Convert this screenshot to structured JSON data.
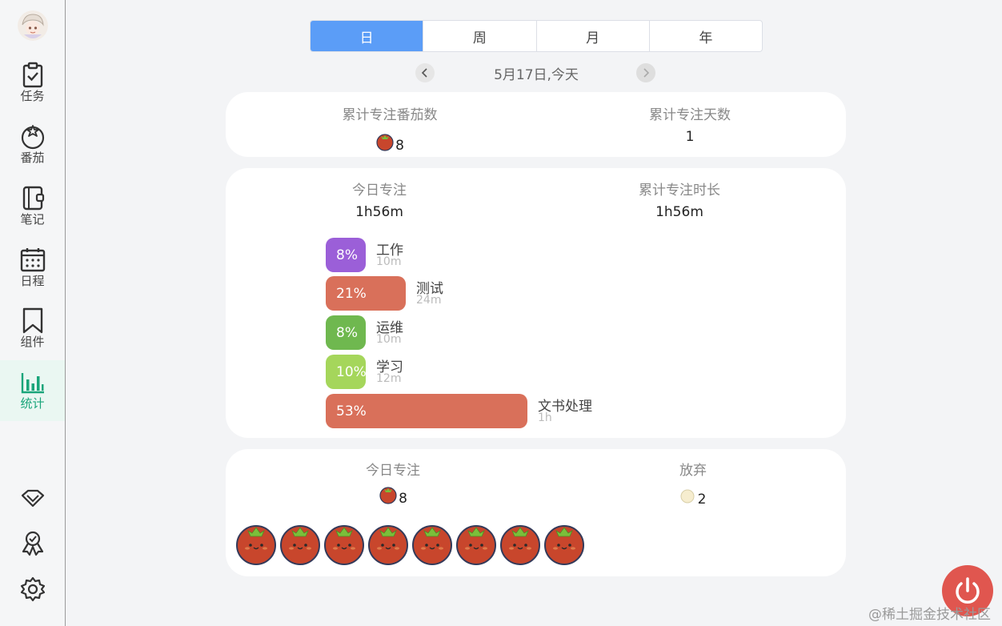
{
  "sidebar": {
    "items": [
      {
        "label": "任务",
        "icon": "task-checklist-icon"
      },
      {
        "label": "番茄",
        "icon": "tomato-icon"
      },
      {
        "label": "笔记",
        "icon": "notebook-icon"
      },
      {
        "label": "日程",
        "icon": "calendar-icon"
      },
      {
        "label": "组件",
        "icon": "bookmark-icon"
      },
      {
        "label": "统计",
        "icon": "bar-chart-icon",
        "active": true
      }
    ],
    "bottom_icons": [
      "diamond-icon",
      "badge-icon",
      "settings-gear-icon"
    ],
    "active_color": "#1aa57a"
  },
  "tabs": [
    {
      "label": "日",
      "active": true
    },
    {
      "label": "周"
    },
    {
      "label": "月"
    },
    {
      "label": "年"
    }
  ],
  "date": {
    "text": "5月17日,今天"
  },
  "summary": {
    "total_pomodoros_label": "累计专注番茄数",
    "total_pomodoros_value": "8",
    "total_days_label": "累计专注天数",
    "total_days_value": "1"
  },
  "focus": {
    "today_label": "今日专注",
    "today_value": "1h56m",
    "total_label": "累计专注时长",
    "total_value": "1h56m",
    "categories": [
      {
        "pct": "8%",
        "name": "工作",
        "duration": "10m",
        "color": "#9b5fd8",
        "fraction": 0.08
      },
      {
        "pct": "21%",
        "name": "测试",
        "duration": "24m",
        "color": "#d9705a",
        "fraction": 0.21
      },
      {
        "pct": "8%",
        "name": "运维",
        "duration": "10m",
        "color": "#6fb84f",
        "fraction": 0.08
      },
      {
        "pct": "10%",
        "name": "学习",
        "duration": "12m",
        "color": "#a5d65b",
        "fraction": 0.1
      },
      {
        "pct": "53%",
        "name": "文书处理",
        "duration": "1h",
        "color": "#d9705a",
        "fraction": 0.53
      }
    ]
  },
  "tomatoes": {
    "today_label": "今日专注",
    "today_count": "8",
    "abandon_label": "放弃",
    "abandon_count": "2",
    "tomato_count": 8
  },
  "watermark": "@稀土掘金技术社区"
}
